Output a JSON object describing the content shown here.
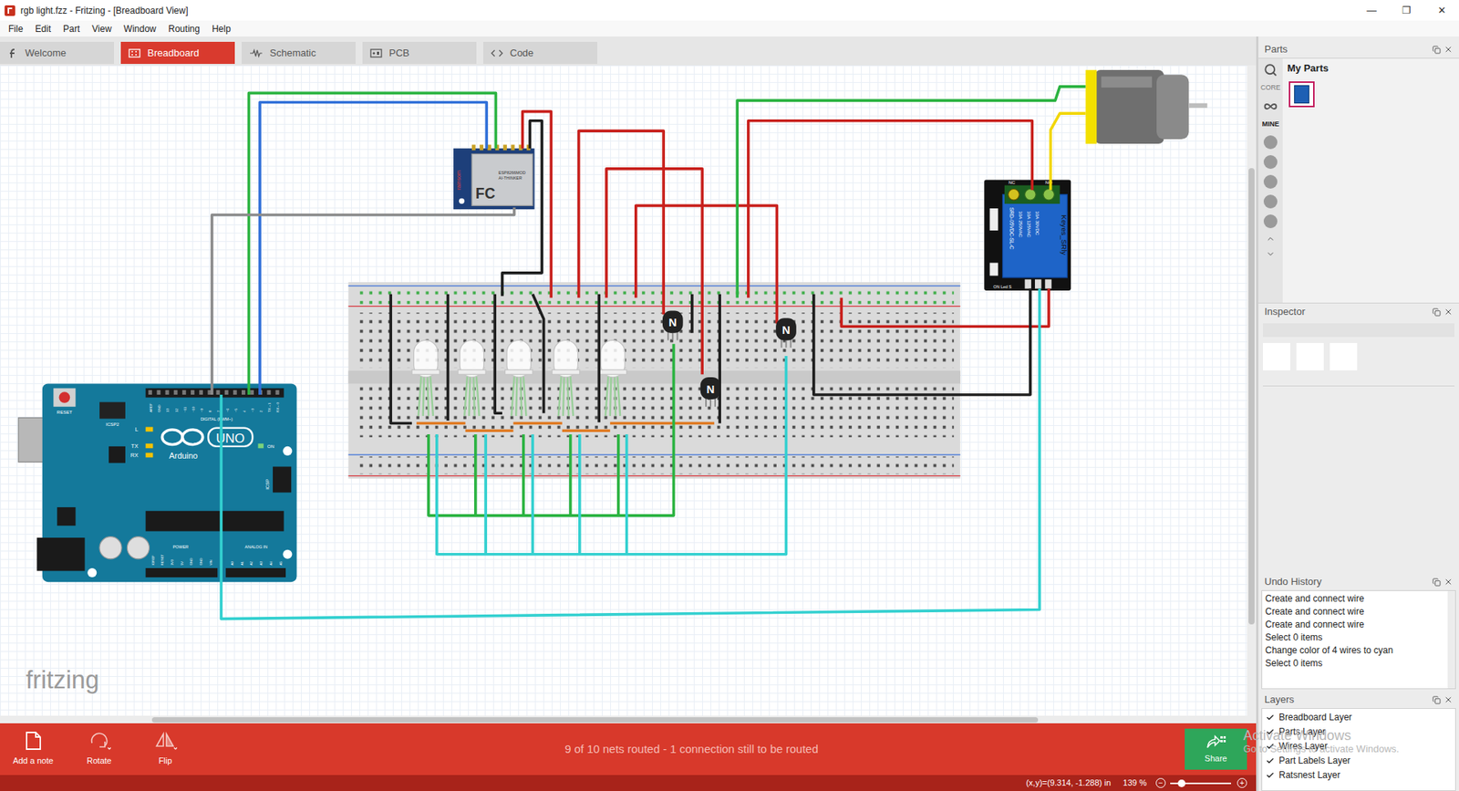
{
  "window": {
    "title": "rgb light.fzz - Fritzing - [Breadboard View]",
    "controls": [
      "—",
      "❐",
      "✕"
    ]
  },
  "menu": [
    "File",
    "Edit",
    "Part",
    "View",
    "Window",
    "Routing",
    "Help"
  ],
  "tabs": [
    {
      "label": "Welcome",
      "selected": false
    },
    {
      "label": "Breadboard",
      "selected": true
    },
    {
      "label": "Schematic",
      "selected": false
    },
    {
      "label": "PCB",
      "selected": false
    },
    {
      "label": "Code",
      "selected": false
    }
  ],
  "canvas": {
    "watermark": "fritzing",
    "arduino": {
      "logo": "UNO",
      "brand": "Arduino",
      "reset": "RESET",
      "icsp2": "ICSP2",
      "led_l": "L",
      "tx": "TX",
      "rx": "RX",
      "on": "ON",
      "icsp": "ICSP",
      "digital": "DIGITAL (PWM~)",
      "power": "POWER",
      "analog": "ANALOG IN",
      "digital_pins": [
        "AREF",
        "GND",
        "13",
        "12",
        "~11",
        "~10",
        "~9",
        "8",
        "7",
        "~6",
        "~5",
        "4",
        "~3",
        "2",
        "TX→1",
        "RX←0"
      ],
      "power_pins": [
        "IOREF",
        "RESET",
        "3V3",
        "5V",
        "GND",
        "GND",
        "VIN"
      ],
      "analog_pins": [
        "A0",
        "A1",
        "A2",
        "A3",
        "A4",
        "A5"
      ]
    },
    "esp": {
      "mark": "FC",
      "model": "ESP8266MOD",
      "vendor": "AI-THINKER",
      "brand": "rainsom"
    },
    "relay": {
      "nc": "NC",
      "no": "NO",
      "name": "Keyes_SRly",
      "model": "SRD-05VDC-SL-C",
      "ratings": [
        "10A 250VAC",
        "10A 125VAC",
        "10A 30VDC"
      ],
      "pins": "ON Led S"
    },
    "transistors": [
      {
        "label": "N"
      },
      {
        "label": "N"
      },
      {
        "label": "N"
      }
    ]
  },
  "toolbar": {
    "buttons": [
      {
        "label": "Add a note"
      },
      {
        "label": "Rotate"
      },
      {
        "label": "Flip"
      }
    ],
    "routing_status": "9 of 10 nets routed - 1 connection still to be routed",
    "share": "Share"
  },
  "status_bar": {
    "coordinates": "(x,y)=(9.314, -1.288) in",
    "zoom": "139 %",
    "zoom_out": "−",
    "zoom_in": "+",
    "zoom_level": 0.12
  },
  "parts": {
    "title": "Parts",
    "bin": "My Parts",
    "bins": [
      {
        "label": "CORE",
        "selected": false
      },
      {
        "label": "MINE",
        "selected": true
      }
    ]
  },
  "inspector": {
    "title": "Inspector"
  },
  "undo_history": {
    "title": "Undo History",
    "items": [
      {
        "label": "Create and connect wire",
        "selected": false
      },
      {
        "label": "Create and connect wire",
        "selected": false
      },
      {
        "label": "Create and connect wire",
        "selected": false
      },
      {
        "label": "Select 0 items",
        "selected": false
      },
      {
        "label": "Change color of 4 wires to cyan",
        "selected": false
      },
      {
        "label": "Select 0 items",
        "selected": false
      }
    ]
  },
  "layers": {
    "title": "Layers",
    "items": [
      {
        "label": "Breadboard Layer",
        "checked": true
      },
      {
        "label": "Parts Layer",
        "checked": true
      },
      {
        "label": "Wires Layer",
        "checked": true
      },
      {
        "label": "Part Labels Layer",
        "checked": true
      },
      {
        "label": "Ratsnest Layer",
        "checked": true
      }
    ]
  },
  "os_watermark": {
    "title": "Activate Windows",
    "subtitle": "Go to Settings to activate Windows."
  }
}
